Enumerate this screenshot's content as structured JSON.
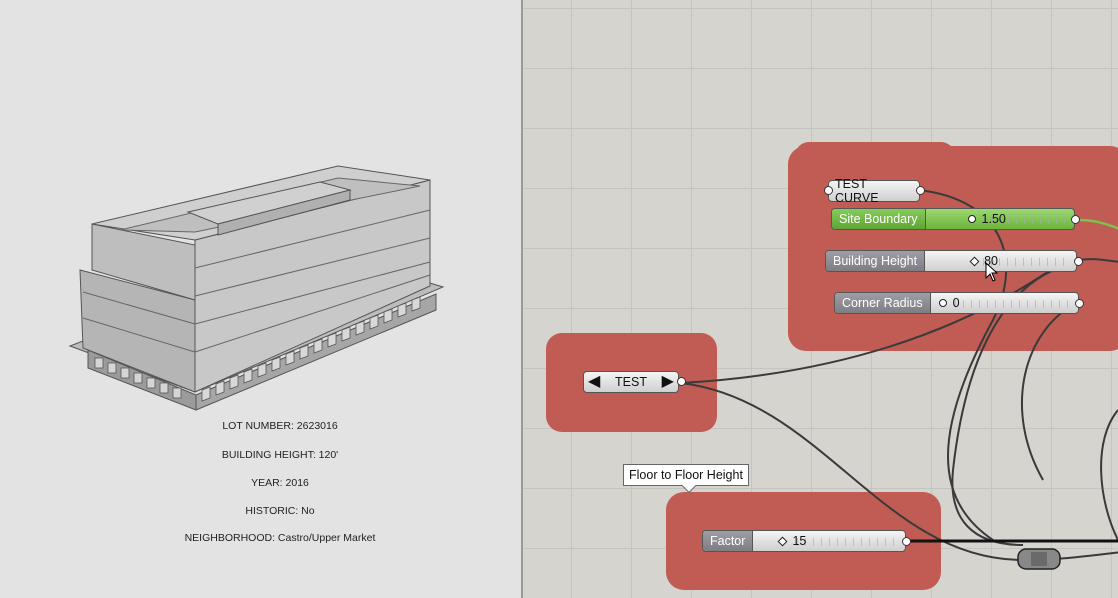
{
  "viewport": {
    "lot_number": "LOT NUMBER: 2623016",
    "building_height": "BUILDING HEIGHT: 120'",
    "year": "YEAR: 2016",
    "historic": "HISTORIC: No",
    "neighborhood": "NEIGHBORHOOD: Castro/Upper Market"
  },
  "canvas": {
    "test_curve_label": "TEST CURVE",
    "test_toggle_label": "TEST",
    "tooltip": "Floor to Floor Height",
    "sliders": [
      {
        "label": "Site Boundary",
        "value": "1.50"
      },
      {
        "label": "Building Height",
        "value": "80"
      },
      {
        "label": "Corner Radius",
        "value": "0"
      },
      {
        "label": "Factor",
        "value": "15"
      }
    ]
  },
  "colors": {
    "group": "#c15c54",
    "active_slider": "#7cc24a",
    "canvas_bg": "#d6d4cf"
  }
}
